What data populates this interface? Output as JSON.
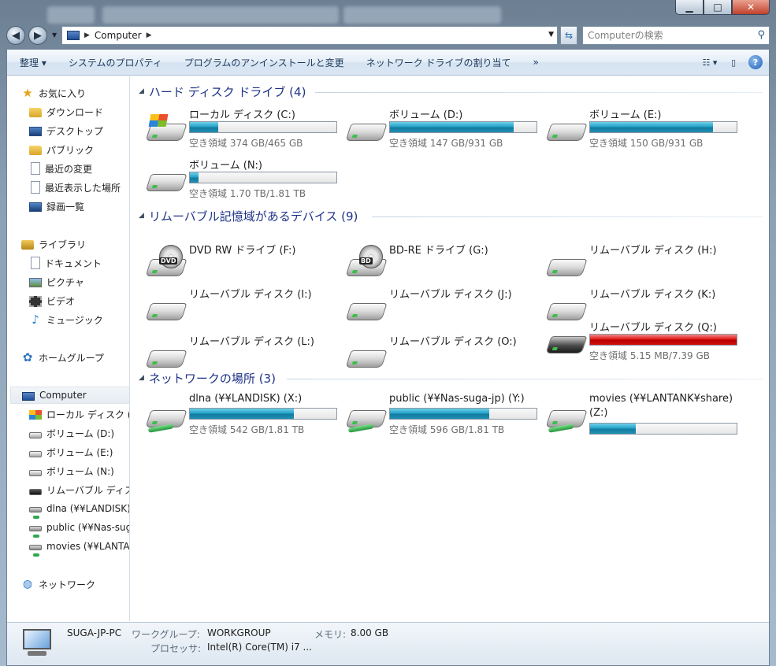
{
  "window": {
    "caption_buttons": {
      "minimize": "▁",
      "maximize": "□",
      "close": "✕"
    }
  },
  "address": {
    "crumb": "Computer",
    "search_placeholder": "Computerの検索"
  },
  "toolbar": {
    "organize": "整理 ▾",
    "system_properties": "システムのプロパティ",
    "uninstall": "プログラムのアンインストールと変更",
    "map_drive": "ネットワーク ドライブの割り当て",
    "more": "»"
  },
  "nav": {
    "favorites": "お気に入り",
    "downloads": "ダウンロード",
    "desktop": "デスクトップ",
    "public": "パブリック",
    "recent_changes": "最近の変更",
    "recent_places": "最近表示した場所",
    "recordings": "録画一覧",
    "libraries": "ライブラリ",
    "documents": "ドキュメント",
    "pictures": "ピクチャ",
    "videos": "ビデオ",
    "music": "ミュージック",
    "homegroup": "ホームグループ",
    "computer": "Computer",
    "local_c": "ローカル ディスク (",
    "vol_d": "ボリューム (D:)",
    "vol_e": "ボリューム (E:)",
    "vol_n": "ボリューム (N:)",
    "removable": "リムーバブル ディス",
    "dlna": "dlna (¥¥LANDISK)",
    "public_nas": "public (¥¥Nas-suga",
    "movies": "movies (¥¥LANTAI",
    "network": "ネットワーク"
  },
  "groups": {
    "hdd": "ハード ディスク ドライブ (4)",
    "removable": "リムーバブル記憶域があるデバイス (9)",
    "network": "ネットワークの場所 (3)"
  },
  "drives": {
    "c": {
      "label": "ローカル ディスク (C:)",
      "free": "空き領域 374 GB/465 GB",
      "used_fraction": 0.196
    },
    "d": {
      "label": "ボリューム (D:)",
      "free": "空き領域 147 GB/931 GB",
      "used_fraction": 0.842
    },
    "e": {
      "label": "ボリューム (E:)",
      "free": "空き領域 150 GB/931 GB",
      "used_fraction": 0.839
    },
    "n": {
      "label": "ボリューム (N:)",
      "free": "空き領域 1.70 TB/1.81 TB",
      "used_fraction": 0.061
    },
    "f": {
      "label": "DVD RW ドライブ (F:)",
      "badge": "DVD"
    },
    "g": {
      "label": "BD-RE ドライブ (G:)",
      "badge": "BD"
    },
    "h": {
      "label": "リムーバブル ディスク (H:)"
    },
    "i": {
      "label": "リムーバブル ディスク (I:)"
    },
    "j": {
      "label": "リムーバブル ディスク (J:)"
    },
    "k": {
      "label": "リムーバブル ディスク (K:)"
    },
    "l": {
      "label": "リムーバブル ディスク (L:)"
    },
    "o": {
      "label": "リムーバブル ディスク (O:)"
    },
    "q": {
      "label": "リムーバブル ディスク (Q:)",
      "free": "空き領域 5.15 MB/7.39 GB",
      "used_fraction": 0.999
    },
    "x": {
      "label": "dlna (¥¥LANDISK) (X:)",
      "free": "空き領域 542 GB/1.81 TB",
      "used_fraction": 0.708
    },
    "y": {
      "label": "public (¥¥Nas-suga-jp) (Y:)",
      "free": "空き領域 596 GB/1.81 TB",
      "used_fraction": 0.678
    },
    "z": {
      "label_line1": "movies (¥¥LANTANK¥share)",
      "label_line2": "(Z:)",
      "used_fraction": 0.31
    }
  },
  "details": {
    "pc_name": "SUGA-JP-PC",
    "workgroup_key": "ワークグループ:",
    "workgroup_val": "WORKGROUP",
    "memory_key": "メモリ:",
    "memory_val": "8.00 GB",
    "cpu_key": "プロセッサ:",
    "cpu_val": "Intel(R) Core(TM) i7 ..."
  },
  "colors": {
    "accent_bar": "#26a2c9",
    "full_bar": "#e01818",
    "group_header": "#1e3287"
  }
}
